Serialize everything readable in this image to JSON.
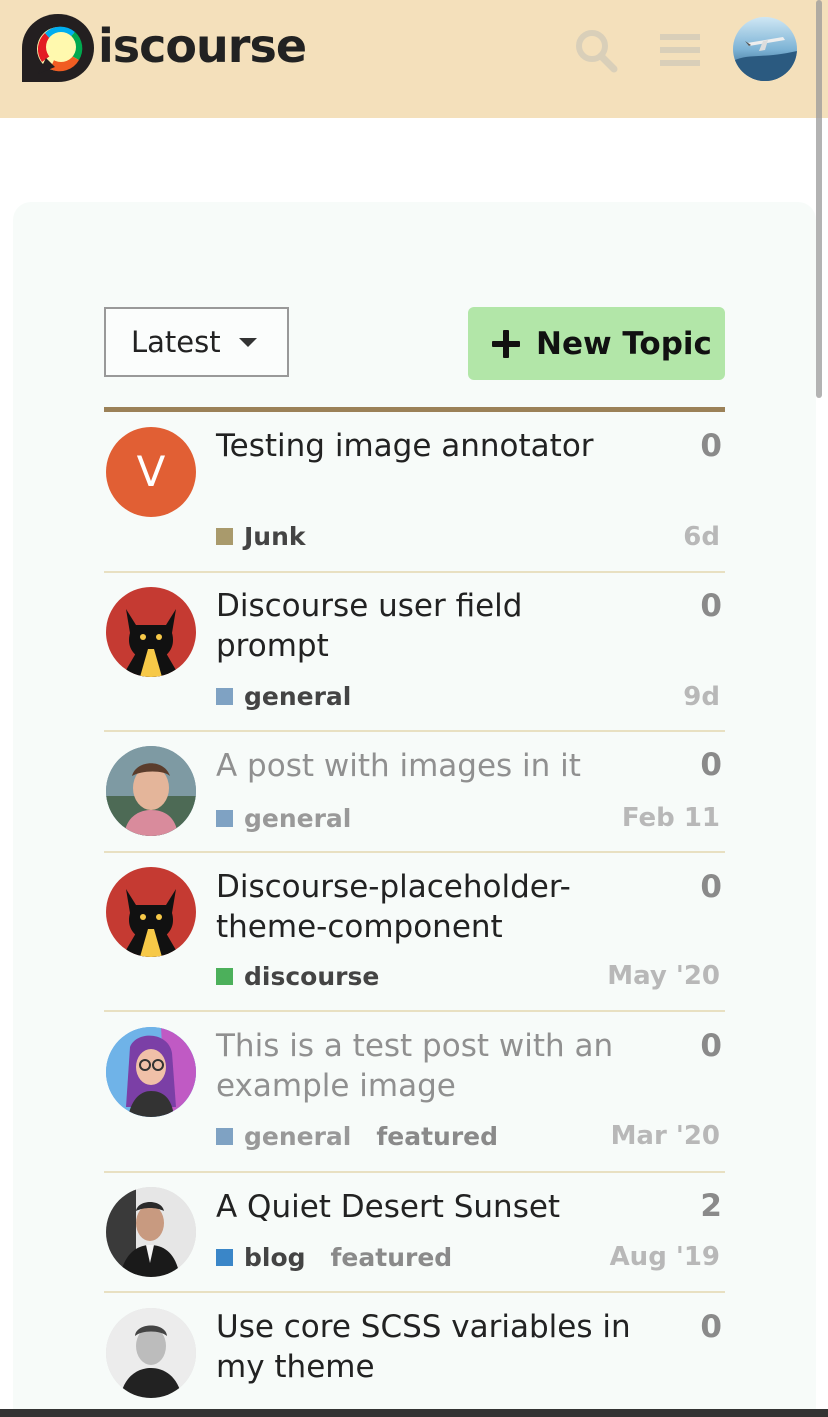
{
  "header": {
    "logo_text": "iscourse",
    "colors": {
      "header_bg": "#f4e0bb",
      "accent_green": "#b2e6a8",
      "border_gold": "#9b8158"
    }
  },
  "controls": {
    "filter_label": "Latest",
    "new_topic_label": "New Topic"
  },
  "topics": [
    {
      "title": "Testing image annotator",
      "replies": "0",
      "category": "Junk",
      "category_color": "#a99a6c",
      "tags": [],
      "age": "6d",
      "read": false,
      "avatar": "letter-v-avatar",
      "avatar_letter": "V"
    },
    {
      "title": "Discourse user field prompt",
      "replies": "0",
      "category": "general",
      "category_color": "#7fa2c3",
      "tags": [],
      "age": "9d",
      "read": false,
      "avatar": "cat-avatar"
    },
    {
      "title": "A post with images in it",
      "replies": "0",
      "category": "general",
      "category_color": "#7fa2c3",
      "tags": [],
      "age": "Feb 11",
      "read": true,
      "avatar": "man-photo-avatar"
    },
    {
      "title": "Discourse-placeholder-theme-component",
      "replies": "0",
      "category": "discourse",
      "category_color": "#4cb05b",
      "tags": [],
      "age": "May '20",
      "read": false,
      "avatar": "cat-avatar"
    },
    {
      "title": "This is a test post with an example image",
      "replies": "0",
      "category": "general",
      "category_color": "#7fa2c3",
      "tags": [
        "featured"
      ],
      "age": "Mar '20",
      "read": true,
      "avatar": "illustrated-avatar"
    },
    {
      "title": "A Quiet Desert Sunset",
      "replies": "2",
      "category": "blog",
      "category_color": "#3a86c8",
      "tags": [
        "featured"
      ],
      "age": "Aug '19",
      "read": false,
      "avatar": "suit-man-avatar"
    },
    {
      "title": "Use core SCSS variables in my theme",
      "replies": "0",
      "category": "",
      "category_color": "",
      "tags": [],
      "age": "",
      "read": false,
      "avatar": "bw-man-avatar"
    }
  ]
}
